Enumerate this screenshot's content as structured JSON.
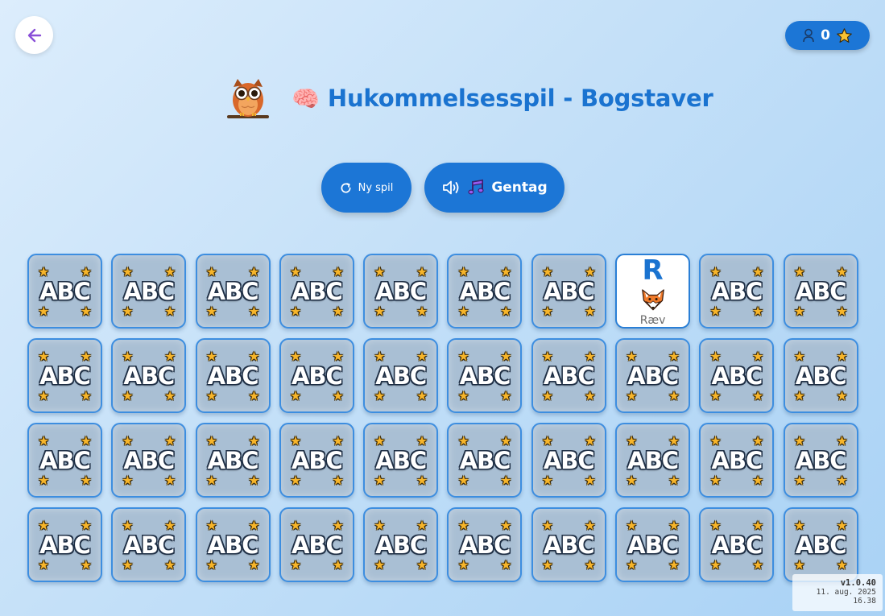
{
  "header": {
    "title": "Hukommelsesspil - Bogstaver",
    "brain_emoji": "🧠",
    "back_icon": "arrow-left-icon",
    "owl_icon": "owl-mascot-icon"
  },
  "score": {
    "value": "0",
    "icon_user": "user-icon",
    "icon_star": "star-icon"
  },
  "controls": {
    "new_game_label": "Ny spil",
    "new_game_icon": "refresh-icon",
    "repeat_label": "Gentag",
    "repeat_icon": "speaker-icon",
    "repeat_music_icon": "music-note-icon"
  },
  "card_back": {
    "text": "ABC",
    "star": "★"
  },
  "revealed_card": {
    "position": 8,
    "letter": "R",
    "word": "Ræv",
    "image": "fox-icon"
  },
  "board": {
    "rows": 4,
    "columns": 10
  },
  "version": {
    "number": "v1.0.40",
    "date": "11. aug. 2025",
    "time": "16.38"
  },
  "colors": {
    "accent": "#1c76d6",
    "title": "#1a73d0",
    "card_back": "#a9bfd4",
    "card_border": "#3d8ee0",
    "star": "#f7b52a"
  }
}
